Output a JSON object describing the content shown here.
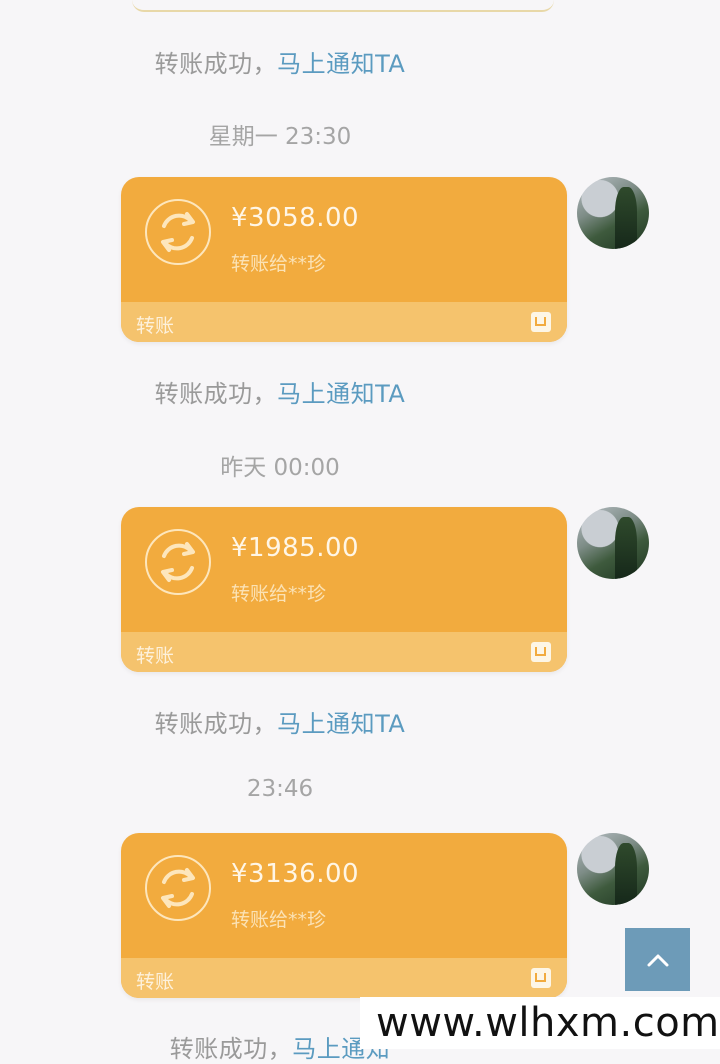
{
  "notice_text": "转账成功，",
  "notice_link": "马上通知TA",
  "messages": [
    {
      "time": "星期一 23:30",
      "amount": "¥3058.00",
      "desc": "转账给**珍",
      "footer": "转账"
    },
    {
      "time": "昨天 00:00",
      "amount": "¥1985.00",
      "desc": "转账给**珍",
      "footer": "转账"
    },
    {
      "time": "23:46",
      "amount": "¥3136.00",
      "desc": "转账给**珍",
      "footer": "转账"
    }
  ],
  "partial_notice_text": "转账成功，",
  "partial_notice_link": "马上通知",
  "watermark": "www.wlhxm.com",
  "icons": {
    "transfer": "transfer-arrows-icon",
    "brand": "wallet-icon",
    "scroll": "chevron-up-icon"
  },
  "colors": {
    "card": "#f2ab3e",
    "card_footer": "#f5c36d",
    "link": "#5b9bc0",
    "scroll_button": "#6d9bb8"
  }
}
